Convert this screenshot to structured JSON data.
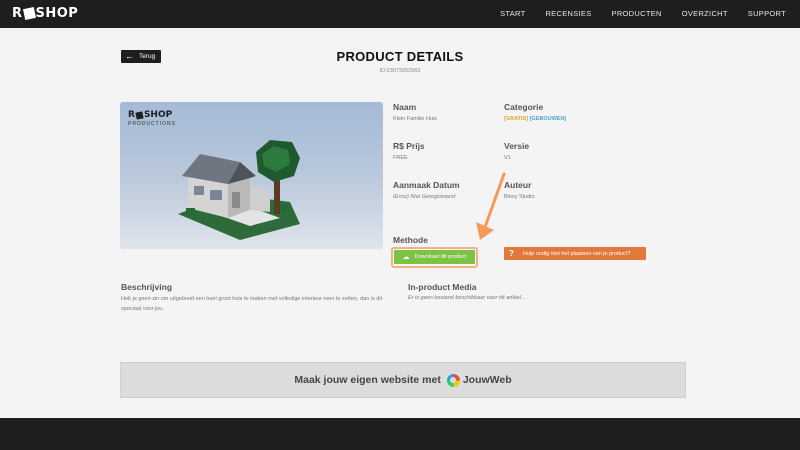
{
  "header": {
    "logo_left": "R",
    "logo_right": "SHOP",
    "nav": [
      "START",
      "RECENSIES",
      "PRODUCTEN",
      "OVERZICHT",
      "SUPPORT"
    ]
  },
  "back_label": "Terug",
  "page": {
    "title": "PRODUCT DETAILS",
    "id": "ID:23073052963"
  },
  "image_logo": {
    "left": "R",
    "right": "SHOP",
    "sub": "PRODUCTIONS"
  },
  "details": {
    "naam_label": "Naam",
    "naam_value": "Klein Familie Huis",
    "categorie_label": "Categorie",
    "categorie_tag1": "[GRATIS]",
    "categorie_tag2": "[GEBOUWEN]",
    "prijs_label": "R$ Prijs",
    "prijs_value": "FREE",
    "versie_label": "Versie",
    "versie_value": "V1",
    "datum_label": "Aanmaak Datum",
    "datum_value": "(Error) Niet Geregistreerd",
    "auteur_label": "Auteur",
    "auteur_value": "Bloxy Studio",
    "methode_label": "Methode"
  },
  "download_label": "Download dit product",
  "help_label": "Hulp nodig met het plaatsen van je product?",
  "beschrijving": {
    "title": "Beschrijving",
    "text": "Heb je geen zin om uitgebreid een heel groot huis te maken met volledige interieur neer te zetten, dan is dit speciaal voor jou."
  },
  "media": {
    "title": "In-product Media",
    "text": "Er is geen bestand beschikbaar voor dit artikel..."
  },
  "ad": {
    "text": "Maak jouw eigen website met",
    "brand": "JouwWeb"
  },
  "colors": {
    "dark": "#1e1e1e",
    "green": "#7cc243",
    "orange": "#e1783c",
    "arrow": "#f39a5a",
    "gold": "#e0a330",
    "blue": "#4aa3d6"
  }
}
